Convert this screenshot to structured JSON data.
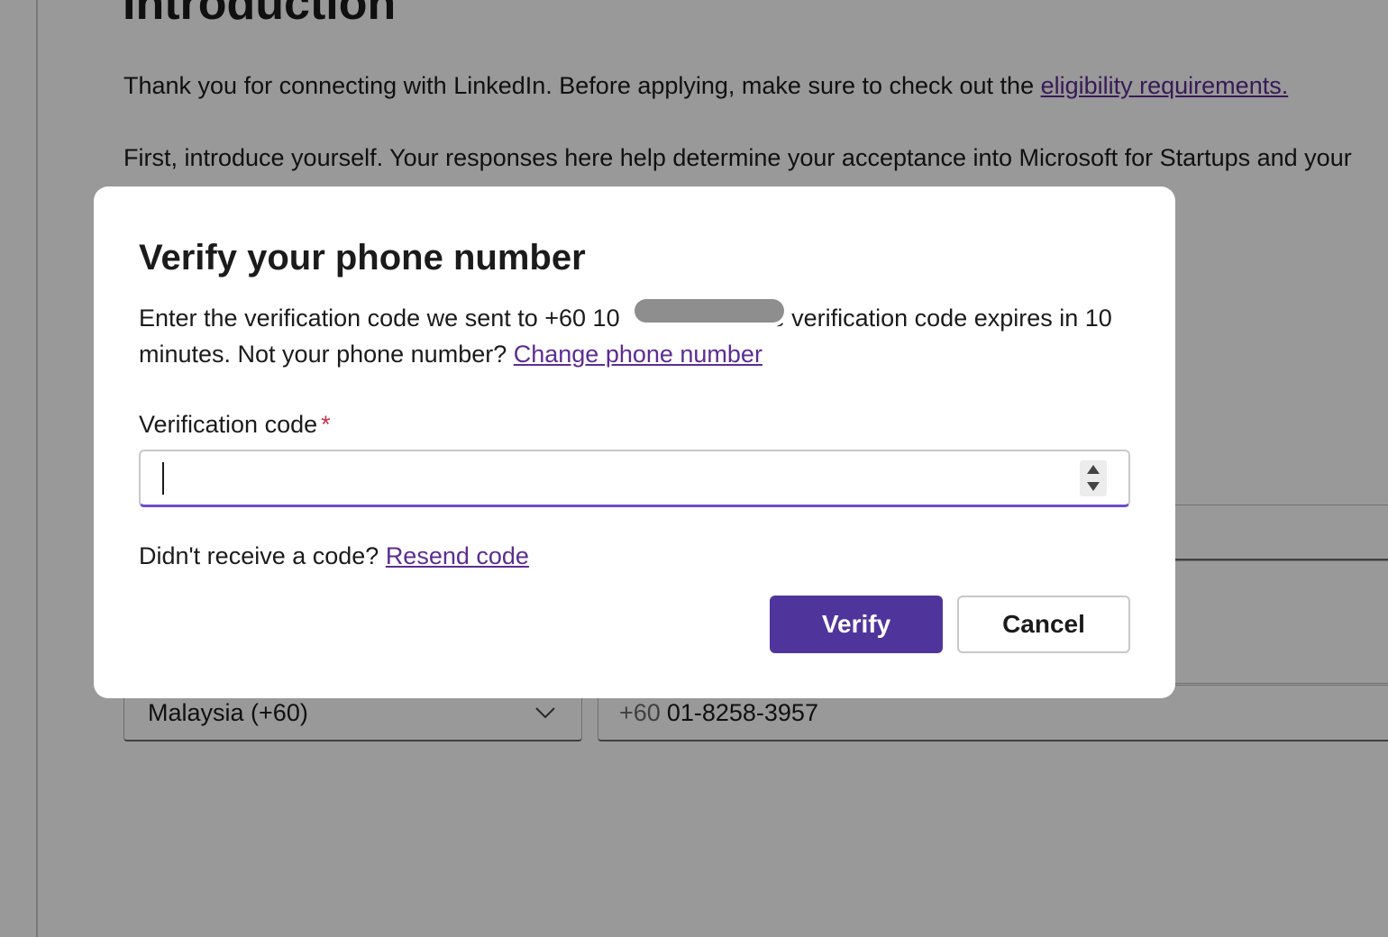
{
  "background": {
    "heading": "Introduction",
    "intro_text": "Thank you for connecting with LinkedIn. Before applying, make sure to check out the ",
    "eligibility_link": "eligibility requirements.",
    "second_para": "First, introduce yourself. Your responses here help determine your acceptance into Microsoft for Startups and your",
    "country_select_value": "Malaysia (+60)",
    "phone_prefix": "+60",
    "phone_value": "01-8258-3957"
  },
  "dialog": {
    "title": "Verify your phone number",
    "desc_part1": "Enter the verification code we sent to +60 10",
    "desc_part2": "e verification code expires in 10 minutes. Not your phone number? ",
    "change_phone_link": "Change phone number",
    "field_label": "Verification code",
    "required_mark": "*",
    "code_value": "",
    "resend_prompt": "Didn't receive a code? ",
    "resend_link": "Resend code",
    "verify_label": "Verify",
    "cancel_label": "Cancel"
  },
  "colors": {
    "accent": "#4f359b",
    "link": "#5c2d91",
    "required": "#c4314b",
    "focus_underline": "#6d4ccf"
  },
  "icons": {
    "country_select": "chevron-down-icon",
    "stepper_up": "caret-up-icon",
    "stepper_down": "caret-down-icon"
  }
}
